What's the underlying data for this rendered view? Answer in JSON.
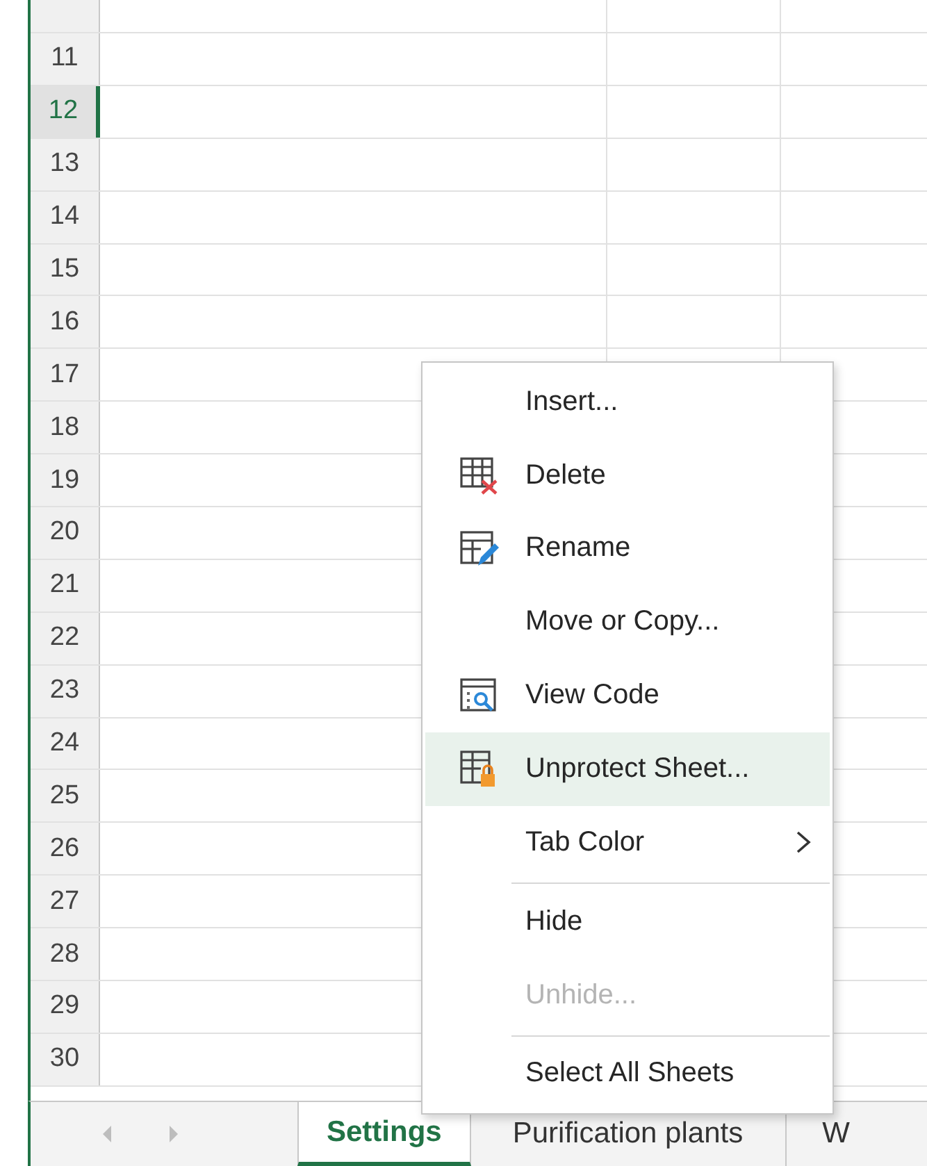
{
  "sheet": {
    "rows": [
      {
        "label": "11",
        "selected": false
      },
      {
        "label": "12",
        "selected": true
      },
      {
        "label": "13",
        "selected": false
      },
      {
        "label": "14",
        "selected": false
      },
      {
        "label": "15",
        "selected": false
      },
      {
        "label": "16",
        "selected": false
      },
      {
        "label": "17",
        "selected": false
      },
      {
        "label": "18",
        "selected": false
      },
      {
        "label": "19",
        "selected": false
      },
      {
        "label": "20",
        "selected": false
      },
      {
        "label": "21",
        "selected": false
      },
      {
        "label": "22",
        "selected": false
      },
      {
        "label": "23",
        "selected": false
      },
      {
        "label": "24",
        "selected": false
      },
      {
        "label": "25",
        "selected": false
      },
      {
        "label": "26",
        "selected": false
      },
      {
        "label": "27",
        "selected": false
      },
      {
        "label": "28",
        "selected": false
      },
      {
        "label": "29",
        "selected": false
      },
      {
        "label": "30",
        "selected": false
      }
    ]
  },
  "context_menu": {
    "items": [
      {
        "label": "Insert...",
        "disabled": false,
        "selected": false,
        "submenu": false,
        "divider_after": false
      },
      {
        "label": "Delete",
        "disabled": false,
        "selected": false,
        "submenu": false,
        "divider_after": false
      },
      {
        "label": "Rename",
        "disabled": false,
        "selected": false,
        "submenu": false,
        "divider_after": false
      },
      {
        "label": "Move or Copy...",
        "disabled": false,
        "selected": false,
        "submenu": false,
        "divider_after": false
      },
      {
        "label": "View Code",
        "disabled": false,
        "selected": false,
        "submenu": false,
        "divider_after": false
      },
      {
        "label": "Unprotect Sheet...",
        "disabled": false,
        "selected": true,
        "submenu": false,
        "divider_after": false
      },
      {
        "label": "Tab Color",
        "disabled": false,
        "selected": false,
        "submenu": true,
        "divider_after": true
      },
      {
        "label": "Hide",
        "disabled": false,
        "selected": false,
        "submenu": false,
        "divider_after": false
      },
      {
        "label": "Unhide...",
        "disabled": true,
        "selected": false,
        "submenu": false,
        "divider_after": true
      },
      {
        "label": "Select All Sheets",
        "disabled": false,
        "selected": false,
        "submenu": false,
        "divider_after": false
      }
    ]
  },
  "sheet_tabs": [
    {
      "label": "Settings",
      "selected": true
    },
    {
      "label": "Purification plants",
      "selected": false
    },
    {
      "label": "W",
      "selected": false
    }
  ]
}
